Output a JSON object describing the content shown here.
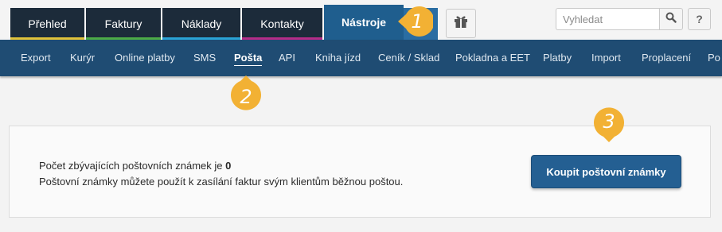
{
  "top_tabs": [
    {
      "label": "Přehled",
      "underline": "#e0c23a"
    },
    {
      "label": "Faktury",
      "underline": "#4cab46"
    },
    {
      "label": "Náklady",
      "underline": "#2aa3d6"
    },
    {
      "label": "Kontakty",
      "underline": "#b52c88"
    },
    {
      "label": "Nástroje",
      "underline": "#1f5e8e"
    }
  ],
  "toolbar": {
    "gift_icon": "gift-icon",
    "search_placeholder": "Vyhledat",
    "search_icon": "search-icon",
    "help_label": "?"
  },
  "subnav": {
    "items": [
      "Export",
      "Kurýr",
      "Online platby",
      "SMS",
      "Pošta",
      "API",
      "Kniha jízd",
      "Ceník / Sklad",
      "Pokladna a EET",
      "Platby",
      "Import",
      "Proplacení",
      "Po"
    ],
    "active": "Pošta"
  },
  "content": {
    "line1_prefix": "Počet zbývajících poštovních známek je ",
    "stamp_count": "0",
    "line2": "Poštovní známky můžete použít k zasílání faktur svým klientům běžnou poštou.",
    "buy_button": "Koupit poštovní známky"
  },
  "markers": [
    "1",
    "2",
    "3"
  ],
  "colors": {
    "marker": "#f2b134",
    "nav_dark": "#1c2b3a",
    "subnav": "#1f4c73",
    "accent": "#245f92"
  }
}
